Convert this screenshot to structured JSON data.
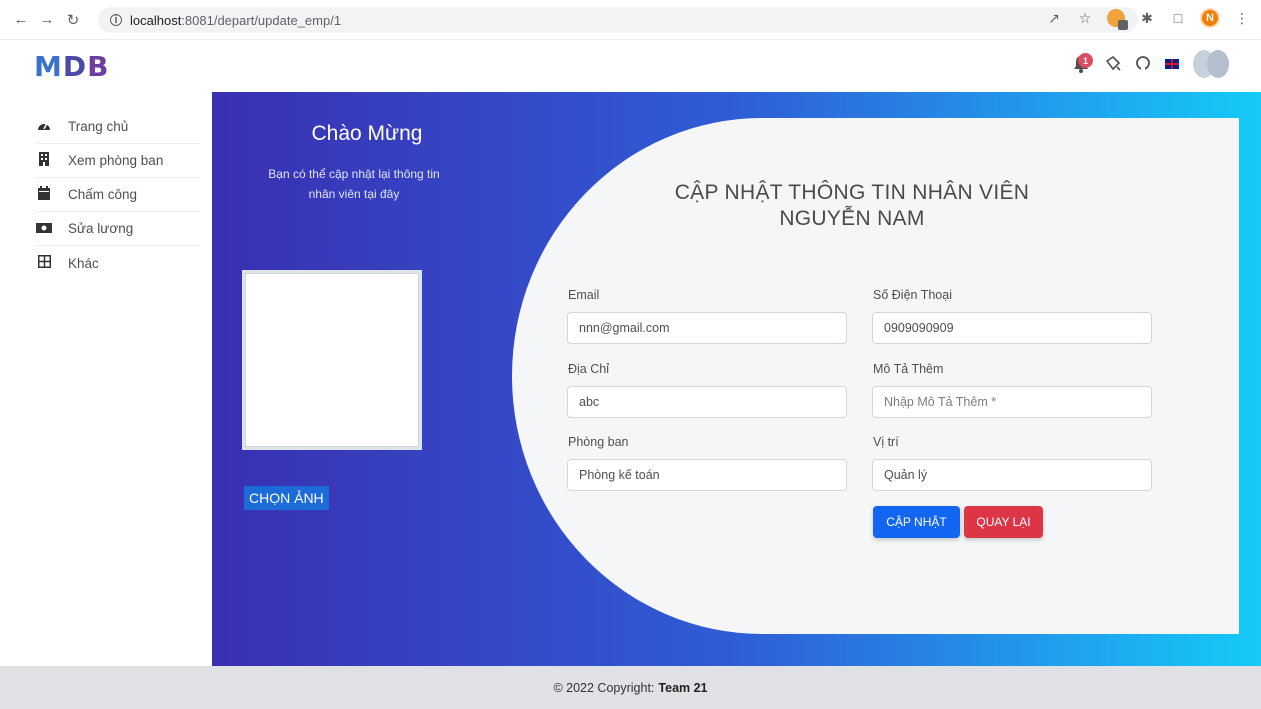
{
  "browser": {
    "url_host": "localhost",
    "url_path": ":8081/depart/update_emp/1"
  },
  "header": {
    "logo": {
      "m": "M",
      "d": "D",
      "b": "B"
    },
    "notification_count": "1"
  },
  "sidebar": {
    "items": [
      {
        "label": "Trang chủ",
        "icon": "gauge-icon"
      },
      {
        "label": "Xem phòng ban",
        "icon": "building-icon"
      },
      {
        "label": "Chấm công",
        "icon": "calendar-icon"
      },
      {
        "label": "Sửa lương",
        "icon": "money-bill-icon"
      },
      {
        "label": "Khác",
        "icon": "grid-icon"
      }
    ]
  },
  "banner": {
    "welcome": "Chào Mừng",
    "welcome_sub": "Bạn có thể cập nhật lại thông tin nhân viên tại đây",
    "choose_image": "CHỌN ẢNH"
  },
  "form": {
    "title_line1": "CẬP NHẬT THÔNG TIN NHÂN VIÊN",
    "title_line2": "NGUYỄN NAM",
    "email_label": "Email",
    "email_value": "nnn@gmail.com",
    "phone_label": "Số Điện Thoại",
    "phone_value": "0909090909",
    "address_label": "Địa Chỉ",
    "address_value": "abc",
    "description_label": "Mô Tả Thêm",
    "description_placeholder": "Nhập Mô Tả Thêm *",
    "department_label": "Phòng ban",
    "department_value": "Phòng kế toán",
    "position_label": "Vị trí",
    "position_value": "Quản lý",
    "update_button": "CẬP NHẬT",
    "back_button": "QUAY LẠI"
  },
  "footer": {
    "copyright": "© 2022 Copyright:",
    "team": "Team 21"
  },
  "colors": {
    "primary": "#1266f1",
    "danger": "#dc3545",
    "banner_start": "#3a2fb2",
    "banner_end": "#14cbf7"
  }
}
